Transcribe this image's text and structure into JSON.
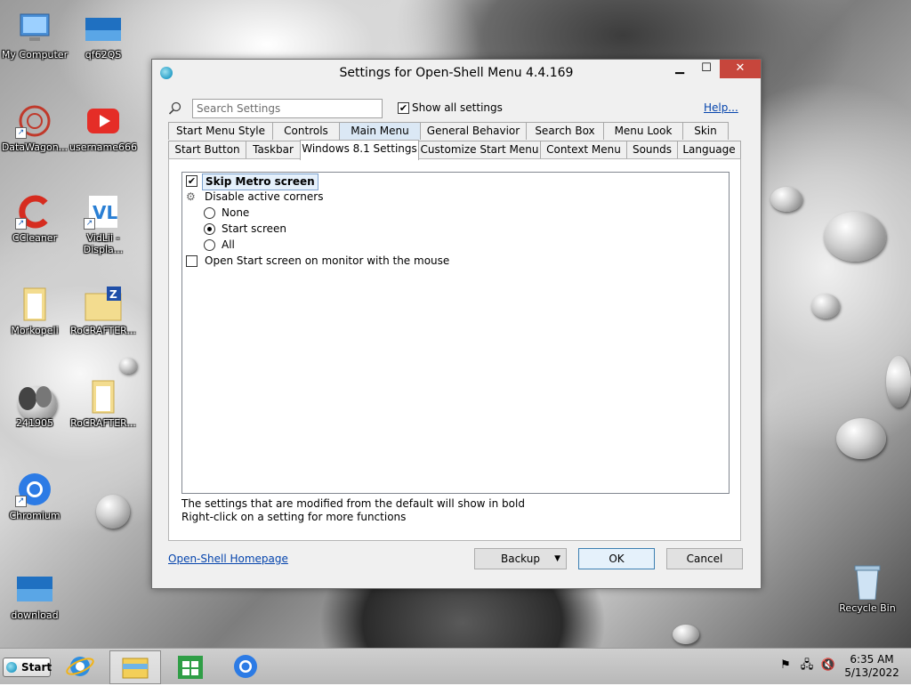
{
  "desktop": {
    "icons": [
      {
        "label": "My Computer"
      },
      {
        "label": "qf62QS"
      },
      {
        "label": "DataWagon..."
      },
      {
        "label": "username666"
      },
      {
        "label": "CCleaner"
      },
      {
        "label": "VidLii - Displa..."
      },
      {
        "label": "Morkopeli"
      },
      {
        "label": "RoCRAFTER..."
      },
      {
        "label": "241905"
      },
      {
        "label": "RoCRAFTER..."
      },
      {
        "label": "Chromium"
      },
      {
        "label": "download"
      },
      {
        "label": "Recycle Bin"
      }
    ]
  },
  "window": {
    "title": "Settings for Open-Shell Menu 4.4.169",
    "minimize": "▁",
    "maximize": "☐",
    "close": "✕",
    "search": {
      "placeholder": "Search Settings",
      "value": ""
    },
    "show_all_label": "Show all settings",
    "show_all_checked": true,
    "help_label": "Help...",
    "tabs_row1": [
      "Start Menu Style",
      "Controls",
      "Main Menu",
      "General Behavior",
      "Search Box",
      "Menu Look",
      "Skin"
    ],
    "tabs_row2": [
      "Start Button",
      "Taskbar",
      "Windows 8.1 Settings",
      "Customize Start Menu",
      "Context Menu",
      "Sounds",
      "Language"
    ],
    "selected_tab": "Windows 8.1 Settings",
    "settings": {
      "skip_metro": {
        "label": "Skip Metro screen",
        "checked": true
      },
      "disable_corners": {
        "label": "Disable active corners"
      },
      "opt_none": {
        "label": "None",
        "selected": false
      },
      "opt_start": {
        "label": "Start screen",
        "selected": true
      },
      "opt_all": {
        "label": "All",
        "selected": false
      },
      "open_start_mouse": {
        "label": "Open Start screen on monitor with the mouse",
        "checked": false
      }
    },
    "note_line1": "The settings that are modified from the default will show in bold",
    "note_line2": "Right-click on a setting for more functions",
    "homepage_link": "Open-Shell Homepage",
    "backup_label": "Backup",
    "ok_label": "OK",
    "cancel_label": "Cancel"
  },
  "taskbar": {
    "start_label": "Start",
    "apps": [
      "internet-explorer-icon",
      "file-explorer-icon",
      "store-icon",
      "chromium-icon"
    ],
    "time": "6:35 AM",
    "date": "5/13/2022"
  },
  "colors": {
    "close_button": "#c7463c",
    "link": "#0645ad",
    "selection": "#e5f0fb"
  }
}
